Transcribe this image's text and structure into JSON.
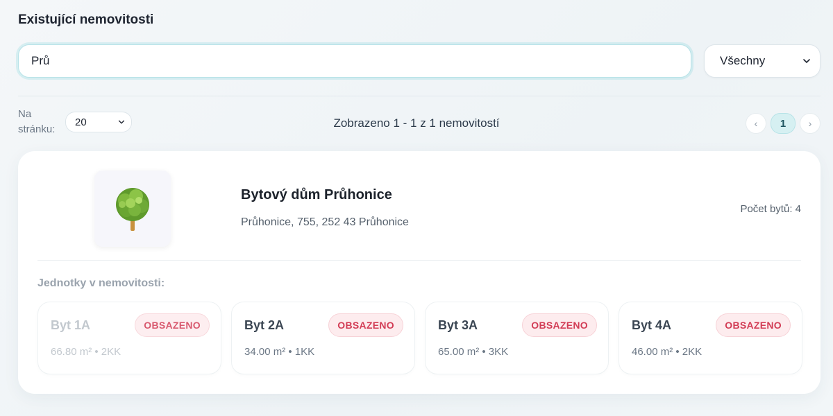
{
  "section_title": "Existující nemovitosti",
  "search": {
    "value": "Prů",
    "placeholder": ""
  },
  "filter": {
    "selected": "Všechny"
  },
  "pagination": {
    "per_page_label": "Na stránku:",
    "per_page_value": "20",
    "showing_text": "Zobrazeno 1 - 1 z 1 nemovitostí",
    "prev_icon": "‹",
    "current_page": "1",
    "next_icon": "›"
  },
  "property": {
    "icon": "tree-icon",
    "name": "Bytový dům Průhonice",
    "address": "Průhonice, 755, 252 43 Průhonice",
    "unit_count": "Počet bytů: 4",
    "units_title": "Jednotky v nemovitosti:",
    "units": [
      {
        "name": "Byt 1A",
        "status": "OBSAZENO",
        "meta": "66.80 m² • 2KK"
      },
      {
        "name": "Byt 2A",
        "status": "OBSAZENO",
        "meta": "34.00 m² • 1KK"
      },
      {
        "name": "Byt 3A",
        "status": "OBSAZENO",
        "meta": "65.00 m² • 3KK"
      },
      {
        "name": "Byt 4A",
        "status": "OBSAZENO",
        "meta": "46.00 m² • 2KK"
      }
    ]
  },
  "colors": {
    "accent": "#b8e3e8",
    "badge_text": "#d23c55",
    "badge_bg": "#fdecee",
    "page_active_bg": "#d6f0f2"
  }
}
